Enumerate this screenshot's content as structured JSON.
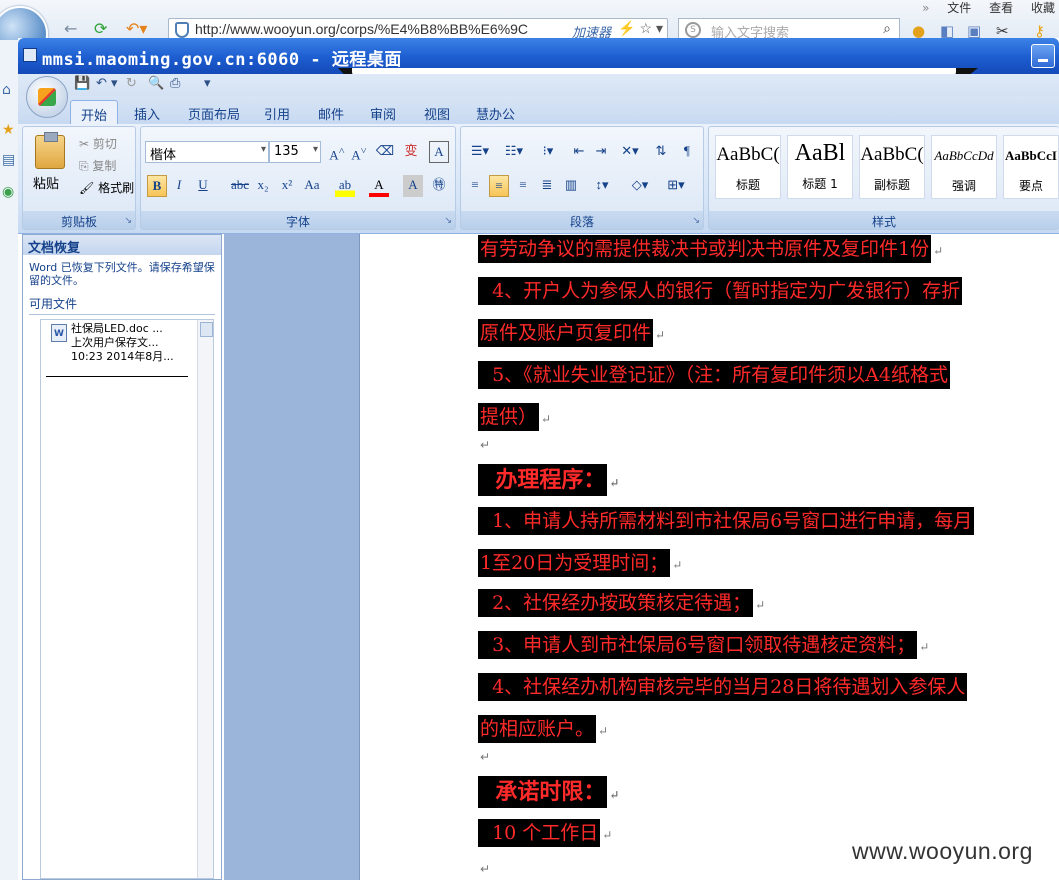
{
  "browser": {
    "url": "http://www.wooyun.org/corps/%E4%B8%BB%E6%9C",
    "accelerator": "加速器",
    "search_placeholder": "输入文字搜索",
    "menu": [
      "文件",
      "查看",
      "收藏"
    ]
  },
  "rdp": {
    "title": "mmsi.maoming.gov.cn:6060 - 远程桌面"
  },
  "ribbon": {
    "tabs": [
      "开始",
      "插入",
      "页面布局",
      "引用",
      "邮件",
      "审阅",
      "视图",
      "慧办公"
    ],
    "clipboard": {
      "paste": "粘贴",
      "cut": "剪切",
      "copy": "复制",
      "format_painter": "格式刷",
      "label": "剪贴板"
    },
    "font": {
      "name": "楷体",
      "size": "135",
      "label": "字体"
    },
    "paragraph": {
      "label": "段落"
    },
    "styles": {
      "label": "样式",
      "items": [
        {
          "sample": "AaBbC(",
          "name": "标题"
        },
        {
          "sample": "AaBl",
          "name": "标题 1"
        },
        {
          "sample": "AaBbC(",
          "name": "副标题"
        },
        {
          "sample": "AaBbCcDd",
          "name": "强调"
        },
        {
          "sample": "AaBbCcI",
          "name": "要点"
        }
      ]
    }
  },
  "recovery": {
    "title": "文档恢复",
    "description": "Word 已恢复下列文件。请保存希望保留的文件。",
    "available": "可用文件",
    "file": {
      "name": "社保局LED.doc",
      "ellipsis": "...",
      "saved": "上次用户保存文...",
      "time": "10:23 2014年8月..."
    }
  },
  "document": {
    "lines": [
      "有劳动争议的需提供裁决书或判决书原件及复印件1份",
      "  4、开户人为参保人的银行（暂时指定为广发银行）存折",
      "原件及账户页复印件",
      "  5、《就业失业登记证》（注：所有复印件须以A4纸格式",
      "提供）",
      "  办理程序：",
      "  1、申请人持所需材料到市社保局6号窗口进行申请，每月",
      "1至20日为受理时间；",
      "  2、社保经办按政策核定待遇；",
      "  3、申请人到市社保局6号窗口领取待遇核定资料；",
      "  4、社保经办机构审核完毕的当月28日将待遇划入参保人",
      "的相应账户。",
      "  承诺时限：",
      "  10 个工作日"
    ]
  },
  "watermark": "www.wooyun.org"
}
